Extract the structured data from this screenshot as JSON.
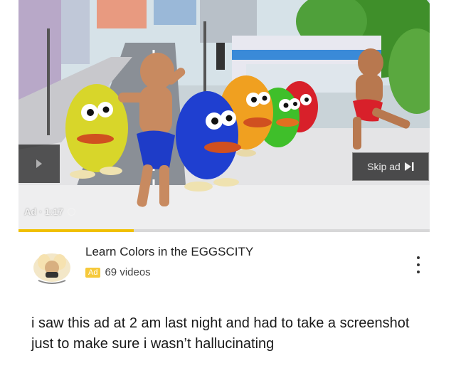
{
  "video": {
    "skip_label": "Skip ad",
    "ad_timer": "Ad · 1:17",
    "progress_fraction": 0.28
  },
  "ad": {
    "title": "Learn Colors in the EGGSCITY",
    "badge": "Ad",
    "video_count": "69 videos"
  },
  "caption": "i saw this ad at 2 am last night and had to take a screenshot just to make sure i wasn’t hallucinating",
  "icons": {
    "skip": "skip-next-icon",
    "timer": "clock-icon",
    "more": "more-vertical-icon",
    "side": "play-arrow-icon"
  },
  "colors": {
    "badge": "#f6c93a",
    "progress": "#f0c000",
    "egg_yellow": "#d8d62a",
    "egg_blue": "#1f3fd0",
    "egg_orange": "#f0a020",
    "egg_green": "#3fbf2a",
    "egg_red": "#d8202a"
  }
}
